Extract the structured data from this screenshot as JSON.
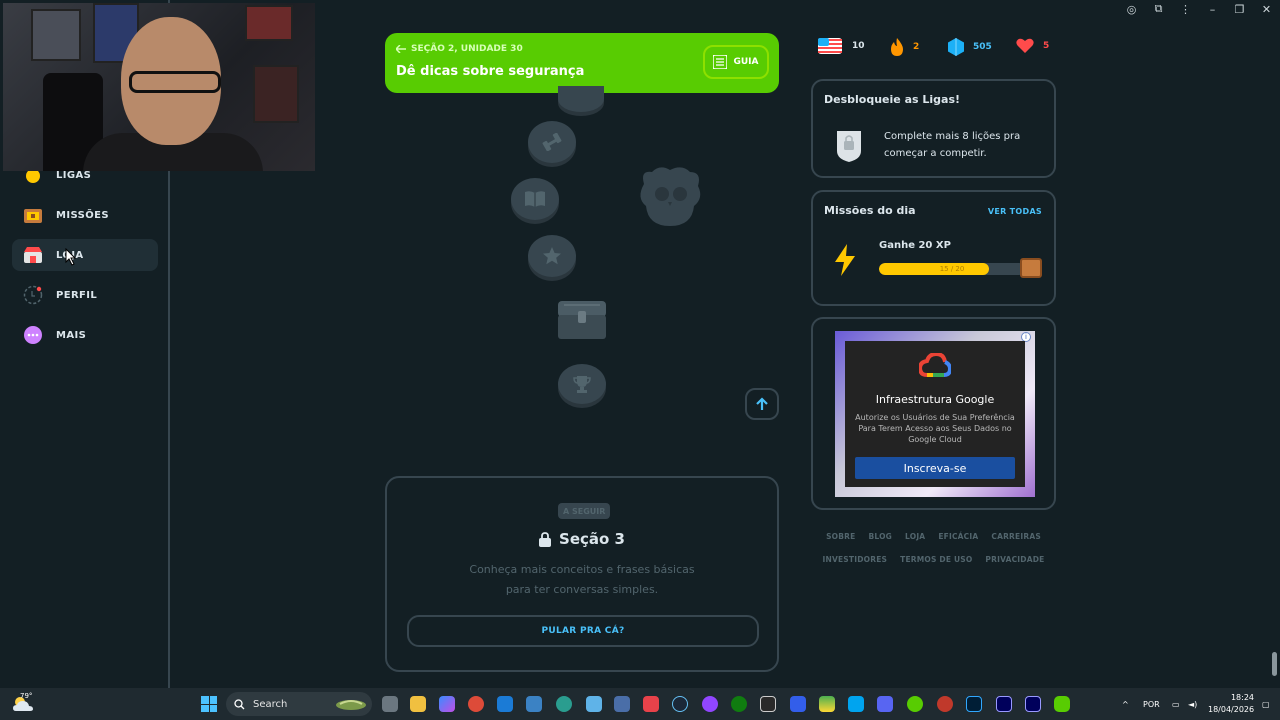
{
  "sidebar": {
    "items": [
      {
        "label": "LIGAS",
        "icon": "league-medal-icon"
      },
      {
        "label": "MISSÕES",
        "icon": "quests-chest-icon"
      },
      {
        "label": "LOJA",
        "icon": "shop-icon"
      },
      {
        "label": "PERFIL",
        "icon": "profile-avatar-icon"
      },
      {
        "label": "MAIS",
        "icon": "more-dots-icon"
      }
    ]
  },
  "unit": {
    "subtitle": "SEÇÃO 2, UNIDADE 30",
    "title": "Dê dicas sobre segurança",
    "guide_label": "GUIA"
  },
  "next_section": {
    "badge": "A SEGUIR",
    "title": "Seção 3",
    "description": "Conheça mais conceitos e frases básicas para ter conversas simples.",
    "skip_label": "PULAR PRA CÁ?"
  },
  "stats": {
    "course_flag": "us-flag-icon",
    "courses": "10",
    "streak": "2",
    "gems": "505",
    "hearts": "5"
  },
  "leagues_card": {
    "title": "Desbloqueie as Ligas!",
    "text": "Complete mais 8 lições pra começar a competir."
  },
  "quests_card": {
    "title": "Missões do dia",
    "see_all": "VER TODAS",
    "quest_name": "Ganhe 20 XP",
    "progress_text": "15 / 20",
    "progress": 0.75
  },
  "ad": {
    "title": "Infraestrutura Google",
    "text": "Autorize os Usuários de Sua Preferência Para Terem Acesso aos Seus Dados no Google Cloud",
    "button": "Inscreva-se"
  },
  "footer": {
    "row1": [
      "SOBRE",
      "BLOG",
      "LOJA",
      "EFICÁCIA",
      "CARREIRAS"
    ],
    "row2": [
      "INVESTIDORES",
      "TERMOS DE USO",
      "PRIVACIDADE"
    ]
  },
  "taskbar": {
    "temperature": "79°",
    "search_placeholder": "Search",
    "language": "POR",
    "time": "18:24",
    "date": "18/04/2026"
  },
  "colors": {
    "background": "#131f24",
    "green": "#58cc02",
    "blue": "#49c0f8",
    "border": "#37464f",
    "gold": "#ffc800"
  }
}
